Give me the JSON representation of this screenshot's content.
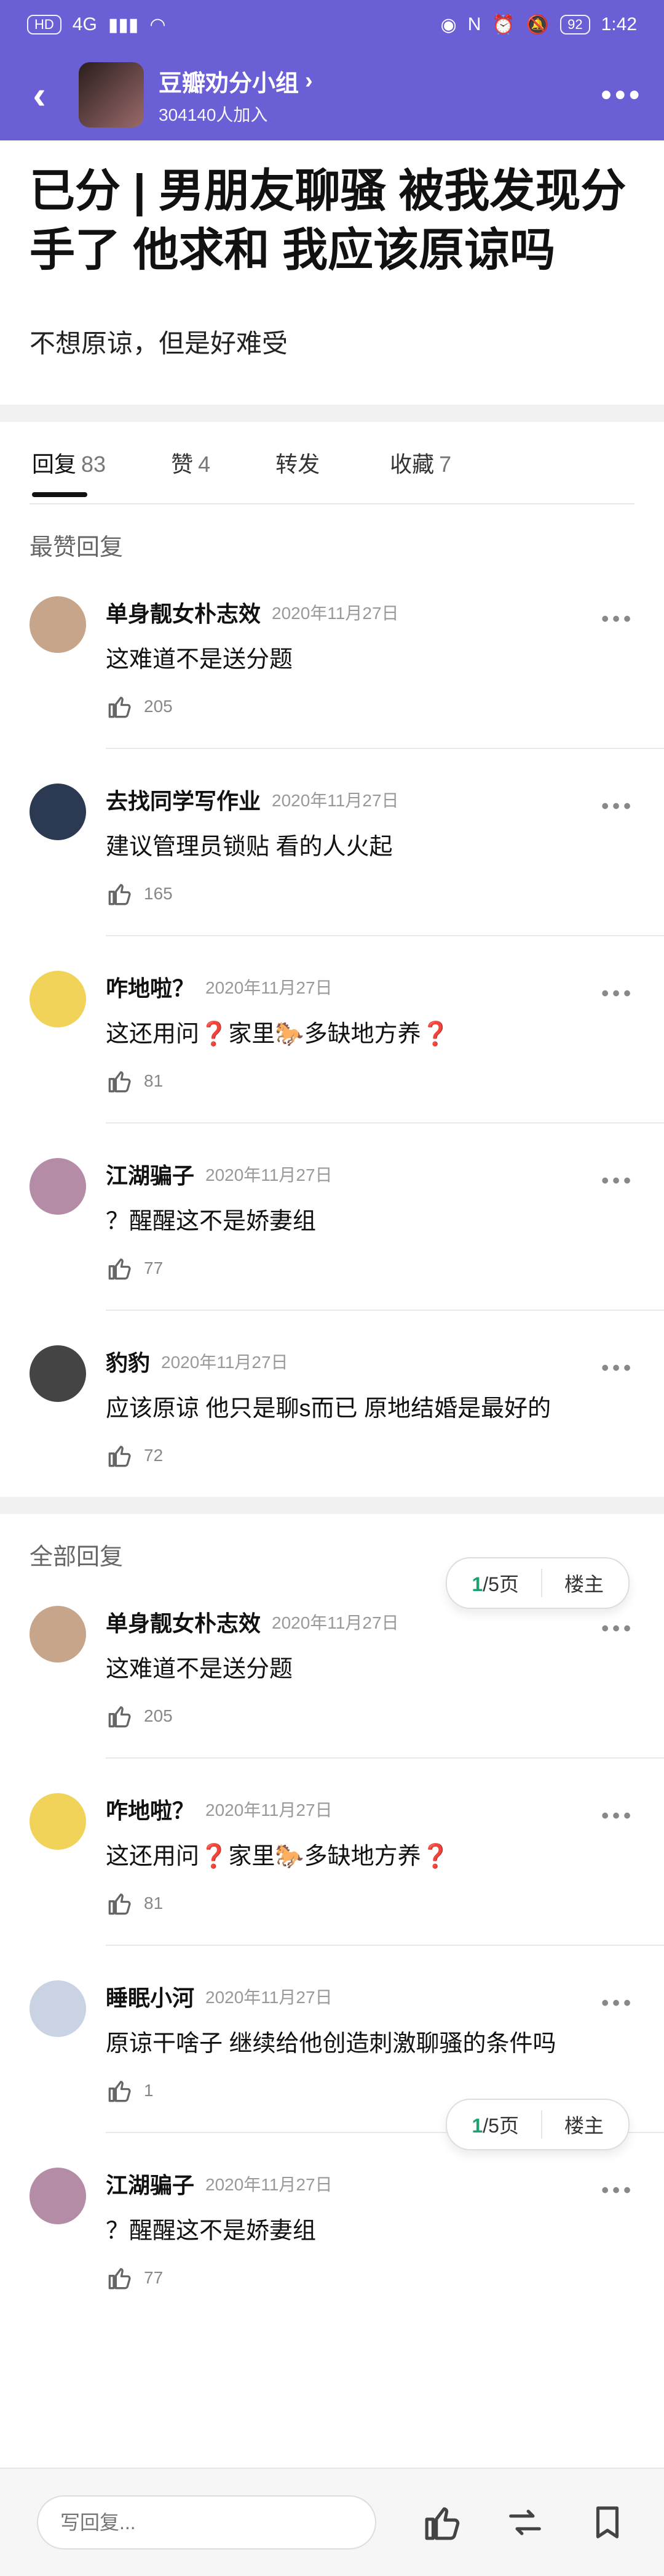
{
  "status": {
    "left_icons": [
      "HD",
      "4G",
      "signal-bars-icon",
      "wifi-icon"
    ],
    "right_icons": [
      "eye-icon",
      "nfc-icon",
      "alarm-icon",
      "mute-icon"
    ],
    "battery": "92",
    "time": "1:42"
  },
  "group": {
    "name": "豆瓣劝分小组",
    "members": "304140人加入"
  },
  "post": {
    "title": "已分 | 男朋友聊骚 被我发现分手了 他求和 我应该原谅吗",
    "desc": "不想原谅，但是好难受"
  },
  "tabs": [
    {
      "label": "回复",
      "count": "83"
    },
    {
      "label": "赞",
      "count": "4"
    },
    {
      "label": "转发",
      "count": ""
    },
    {
      "label": "收藏",
      "count": "7"
    }
  ],
  "sections": {
    "top": "最赞回复",
    "all": "全部回复"
  },
  "top_comments": [
    {
      "name": "单身靓女朴志效",
      "time": "2020年11月27日",
      "text": "这难道不是送分题",
      "likes": "205",
      "avatar_color": "#c7a58a"
    },
    {
      "name": "去找同学写作业",
      "time": "2020年11月27日",
      "text": "建议管理员锁贴  看的人火起",
      "likes": "165",
      "avatar_color": "#2b3a52"
    },
    {
      "name": "咋地啦？",
      "time": "2020年11月27日",
      "text": "这还用问❓家里🐎多缺地方养❓",
      "likes": "81",
      "avatar_color": "#f1d35a"
    },
    {
      "name": "江湖骗子",
      "time": "2020年11月27日",
      "text": "？醒醒这不是娇妻组",
      "likes": "77",
      "avatar_color": "#b58ca6"
    },
    {
      "name": "豹豹",
      "time": "2020年11月27日",
      "text": "应该原谅 他只是聊s而已 原地结婚是最好的",
      "likes": "72",
      "avatar_color": "#444444"
    }
  ],
  "all_comments": [
    {
      "name": "单身靓女朴志效",
      "time": "2020年11月27日",
      "text": "这难道不是送分题",
      "likes": "205",
      "avatar_color": "#c7a58a"
    },
    {
      "name": "咋地啦？",
      "time": "2020年11月27日",
      "text": "这还用问❓家里🐎多缺地方养❓",
      "likes": "81",
      "avatar_color": "#f1d35a"
    },
    {
      "name": "睡眠小河",
      "time": "2020年11月27日",
      "text": "原谅干啥子 继续给他创造刺激聊骚的条件吗",
      "likes": "1",
      "avatar_color": "#c9d3e3"
    },
    {
      "name": "江湖骗子",
      "time": "2020年11月27日",
      "text": "？醒醒这不是娇妻组",
      "likes": "77",
      "avatar_color": "#b58ca6"
    }
  ],
  "pager": {
    "current": "1",
    "total": "/5页",
    "owner": "楼主"
  },
  "reply_placeholder": "写回复..."
}
